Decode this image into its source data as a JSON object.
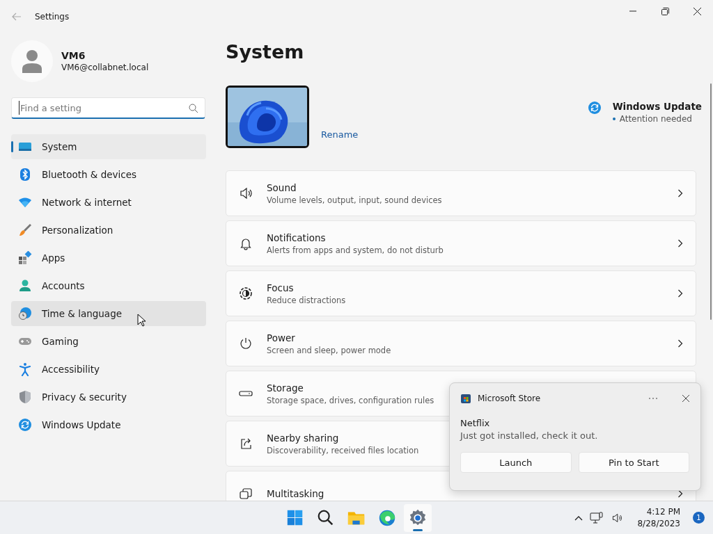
{
  "window": {
    "title": "Settings"
  },
  "profile": {
    "name": "VM6",
    "email": "VM6@collabnet.local"
  },
  "search": {
    "placeholder": "Find a setting"
  },
  "sidebar": {
    "items": [
      {
        "label": "System",
        "selected": true,
        "hovered": false
      },
      {
        "label": "Bluetooth & devices",
        "selected": false,
        "hovered": false
      },
      {
        "label": "Network & internet",
        "selected": false,
        "hovered": false
      },
      {
        "label": "Personalization",
        "selected": false,
        "hovered": false
      },
      {
        "label": "Apps",
        "selected": false,
        "hovered": false
      },
      {
        "label": "Accounts",
        "selected": false,
        "hovered": false
      },
      {
        "label": "Time & language",
        "selected": false,
        "hovered": true
      },
      {
        "label": "Gaming",
        "selected": false,
        "hovered": false
      },
      {
        "label": "Accessibility",
        "selected": false,
        "hovered": false
      },
      {
        "label": "Privacy & security",
        "selected": false,
        "hovered": false
      },
      {
        "label": "Windows Update",
        "selected": false,
        "hovered": false
      }
    ]
  },
  "page": {
    "title": "System",
    "device": {
      "kind": "picture",
      "link": "Rename"
    },
    "update": {
      "title": "Windows Update",
      "status": "Attention needed"
    },
    "cards": [
      {
        "title": "Sound",
        "subtitle": "Volume levels, output, input, sound devices",
        "chevron": true
      },
      {
        "title": "Notifications",
        "subtitle": "Alerts from apps and system, do not disturb",
        "chevron": true
      },
      {
        "title": "Focus",
        "subtitle": "Reduce distractions",
        "chevron": true
      },
      {
        "title": "Power",
        "subtitle": "Screen and sleep, power mode",
        "chevron": true
      },
      {
        "title": "Storage",
        "subtitle": "Storage space, drives, configuration rules",
        "chevron": false
      },
      {
        "title": "Nearby sharing",
        "subtitle": "Discoverability, received files location",
        "chevron": false
      },
      {
        "title": "Multitasking",
        "chevron": true
      }
    ]
  },
  "toast": {
    "app": "Microsoft Store",
    "title": "Netflix",
    "body": "Just got installed, check it out.",
    "buttons": [
      "Launch",
      "Pin to Start"
    ]
  },
  "taskbar": {
    "apps": [
      {
        "selected": false
      },
      {
        "selected": false
      },
      {
        "selected": false
      },
      {
        "selected": false
      },
      {
        "selected": true
      }
    ],
    "time": "4:12 PM",
    "date": "8/28/2023",
    "badge": "1"
  }
}
